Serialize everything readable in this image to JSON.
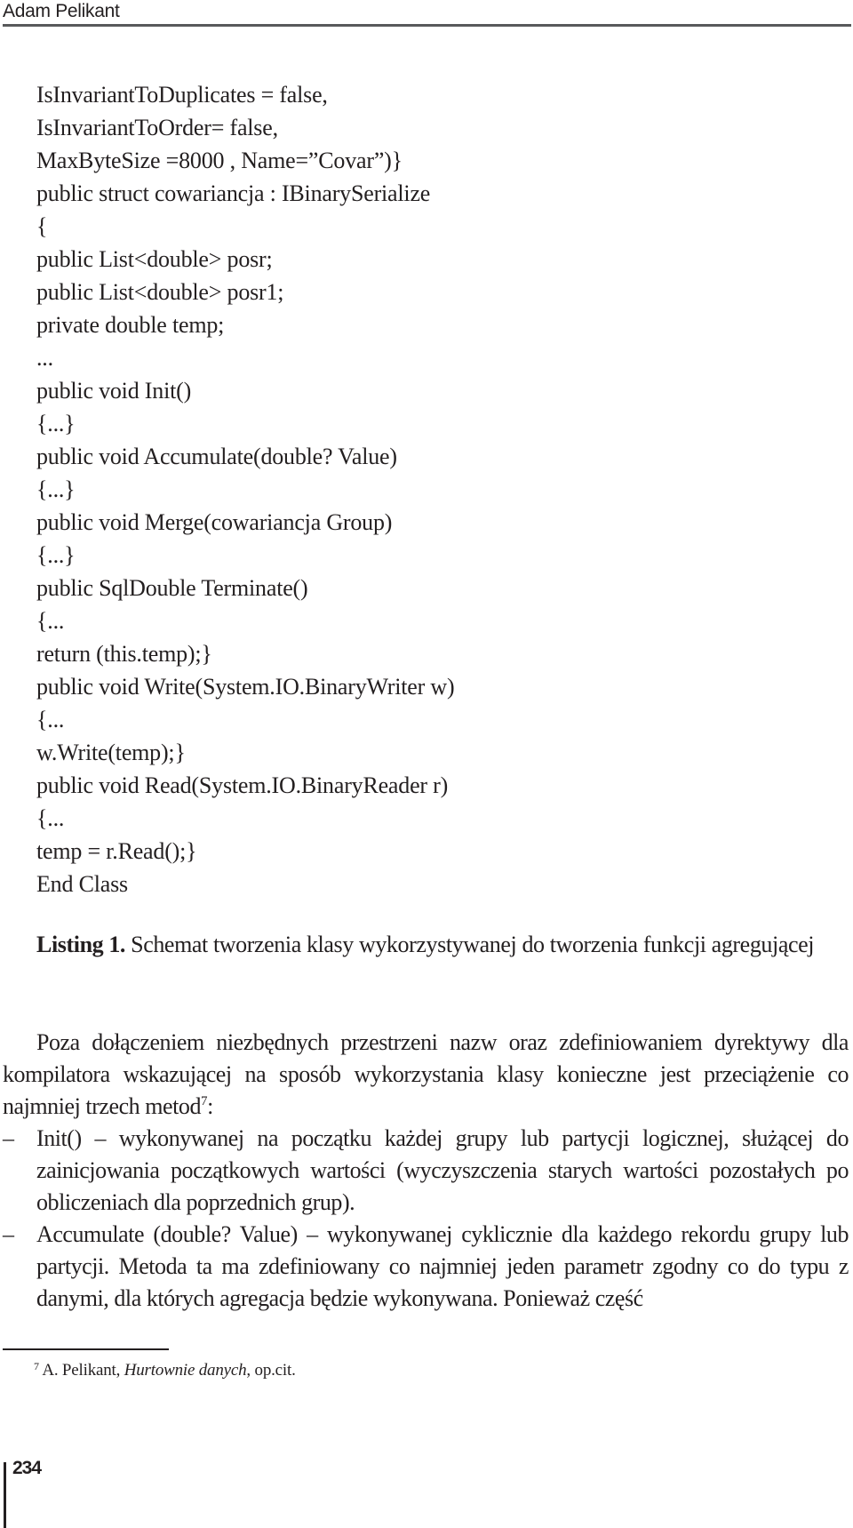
{
  "header": {
    "running_head": "Adam Pelikant"
  },
  "listing": {
    "code_lines": [
      "IsInvariantToDuplicates = false,",
      "IsInvariantToOrder= false,",
      "MaxByteSize =8000 , Name=”Covar”)}",
      "public struct cowariancja : IBinarySerialize",
      "{",
      "public List<double> posr;",
      "public List<double> posr1;",
      "private double temp;",
      "...",
      "public void Init()",
      "{...}",
      "public void Accumulate(double? Value)",
      "{...}",
      "public void Merge(cowariancja Group)",
      "{...}",
      "public SqlDouble Terminate()",
      "{...",
      "return (this.temp);}",
      "public void Write(System.IO.BinaryWriter w)",
      "{...",
      "w.Write(temp);}",
      "public void Read(System.IO.BinaryReader r)",
      "{...",
      "temp = r.Read();}",
      "End Class"
    ],
    "caption_label": "Listing 1.",
    "caption_text": " Schemat tworzenia klasy wykorzystywanej do tworzenia funkcji agregującej"
  },
  "body": {
    "paragraph_text": "Poza dołączeniem niezbędnych przestrzeni nazw oraz zdefiniowaniem dyrektywy dla kompilatora wskazującej na sposób wykorzystania klasy konieczne jest przeciążenie co najmniej trzech metod",
    "paragraph_footnote_ref": "7",
    "paragraph_end": ":",
    "list_items": [
      {
        "dash": "–",
        "text": "Init() – wykonywanej na początku każdej grupy lub partycji logicznej, służącej do zainicjowania początkowych wartości (wyczyszczenia starych wartości pozostałych po obliczeniach dla poprzednich grup)."
      },
      {
        "dash": "–",
        "text": "Accumulate (double? Value) – wykonywanej cyklicznie dla każdego rekordu grupy lub partycji. Metoda ta ma zdefiniowany co najmniej jeden parametr zgodny co do typu z danymi, dla których agregacja będzie wykonywana. Ponieważ część"
      }
    ]
  },
  "footnote": {
    "number": "7",
    "author": " A. Pelikant, ",
    "title": "Hurtownie danych",
    "rest": ", op.cit."
  },
  "page": {
    "number": "234"
  }
}
